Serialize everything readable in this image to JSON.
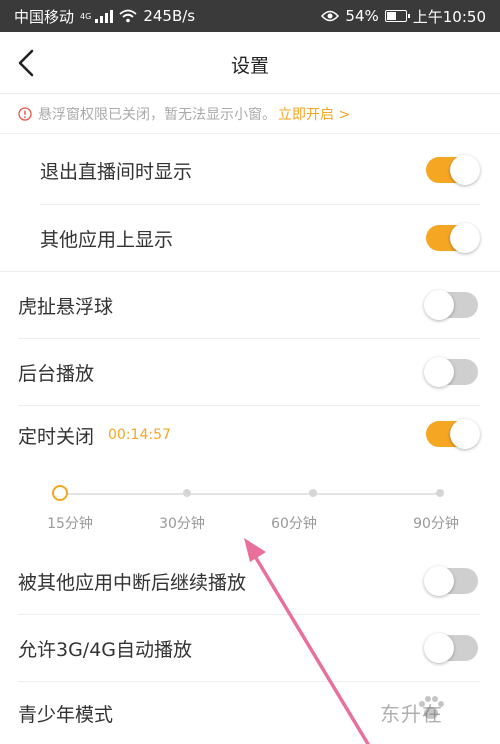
{
  "status_bar": {
    "carrier": "中国移动",
    "network": "4G",
    "speed": "245B/s",
    "battery": "54%",
    "battery_level": 0.54,
    "time": "上午10:50"
  },
  "header": {
    "title": "设置"
  },
  "notice": {
    "text": "悬浮窗权限已关闭，暂无法显示小窗。",
    "link": "立即开启 >"
  },
  "settings": [
    {
      "label": "退出直播间时显示",
      "on": true
    },
    {
      "label": "其他应用上显示",
      "on": true
    },
    {
      "label": "虎扯悬浮球",
      "on": false
    },
    {
      "label": "后台播放",
      "on": false
    },
    {
      "label": "定时关闭",
      "timer": "00:14:57",
      "on": true
    },
    {
      "label": "被其他应用中断后继续播放",
      "on": false
    },
    {
      "label": "允许3G/4G自动播放",
      "on": false
    },
    {
      "label": "青少年模式"
    }
  ],
  "timer_slider": {
    "options": [
      "15分钟",
      "30分钟",
      "60分钟",
      "90分钟"
    ],
    "selected_index": 0
  },
  "colors": {
    "accent": "#f5a623",
    "toggle_off": "#cfcfcf",
    "status_bar": "#3a3a3a",
    "annotation_arrow": "#e8709a"
  },
  "watermark": {
    "text": "东升在"
  }
}
